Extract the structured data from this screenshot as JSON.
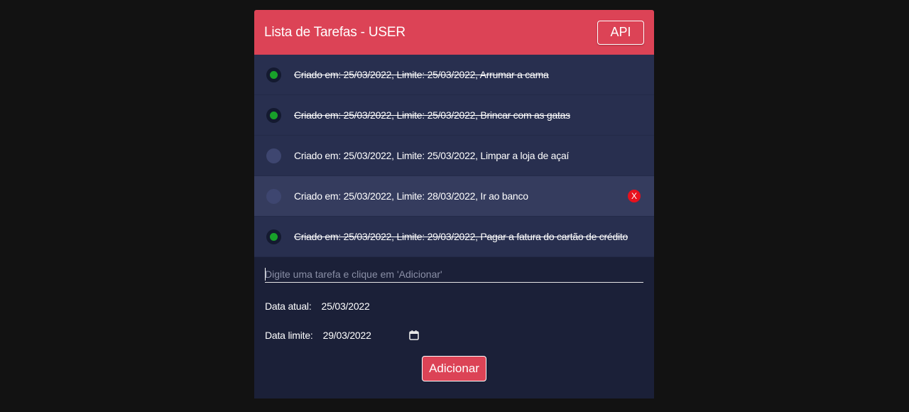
{
  "header": {
    "title": "Lista de Tarefas - USER",
    "api_label": "API"
  },
  "tasks": [
    {
      "text": "Criado em: 25/03/2022, Limite: 25/03/2022, Arrumar a cama",
      "done": true
    },
    {
      "text": "Criado em: 25/03/2022, Limite: 25/03/2022, Brincar com as gatas",
      "done": true
    },
    {
      "text": "Criado em: 25/03/2022, Limite: 25/03/2022, Limpar a loja de açaí",
      "done": false
    },
    {
      "text": "Criado em: 25/03/2022, Limite: 28/03/2022, Ir ao banco",
      "done": false,
      "hovered": true,
      "delete_label": "X"
    },
    {
      "text": "Criado em: 25/03/2022, Limite: 29/03/2022, Pagar a fatura do cartão de crédito",
      "done": true
    }
  ],
  "form": {
    "input_placeholder": "Digite uma tarefa e clique em 'Adicionar'",
    "input_value": "",
    "current_date_label": "Data atual:",
    "current_date_value": "25/03/2022",
    "limit_date_label": "Data limite:",
    "limit_date_value": "29/03/2022",
    "add_label": "Adicionar"
  },
  "colors": {
    "accent": "#dc4356",
    "card_bg": "#1b2038",
    "item_bg": "#282f4f",
    "done_dot": "#18a02a",
    "delete": "#e8111d"
  },
  "icons": {
    "calendar": "calendar-icon",
    "radio": "radio-icon"
  }
}
